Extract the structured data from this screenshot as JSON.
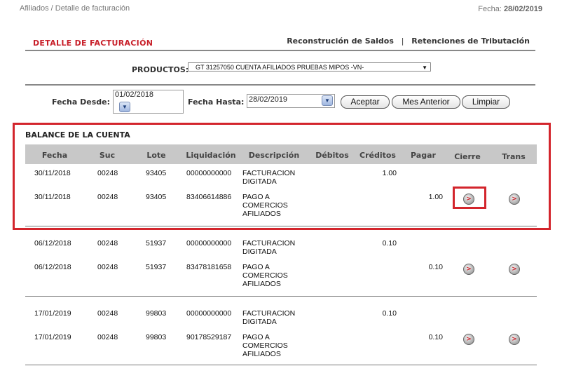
{
  "header": {
    "breadcrumb": "Afiliados / Detalle de facturación",
    "fecha_label": "Fecha:",
    "fecha_value": "28/02/2019"
  },
  "page_title": "DETALLE DE FACTURACIÓN",
  "links": {
    "reconstruccion": "Reconstrución de Saldos",
    "separator": "|",
    "retenciones": "Retenciones de Tributación"
  },
  "productos": {
    "label": "PRODUCTOS:",
    "selected": "GT 31257050 CUENTA AFILIADOS PRUEBAS MIPOS -VN-"
  },
  "filters": {
    "desde_label": "Fecha Desde:",
    "desde_value": "01/02/2018",
    "hasta_label": "Fecha Hasta:",
    "hasta_value": "28/02/2019",
    "aceptar": "Aceptar",
    "mes_anterior": "Mes Anterior",
    "limpiar": "Limpiar"
  },
  "balance": {
    "title": "BALANCE DE LA CUENTA",
    "columns": [
      "Fecha",
      "Suc",
      "Lote",
      "Liquidación",
      "Descripción",
      "Débitos",
      "Créditos",
      "Pagar",
      "Cierre",
      "Trans"
    ],
    "rows": [
      {
        "fecha": "30/11/2018",
        "suc": "00248",
        "lote": "93405",
        "liq": "00000000000",
        "desc": [
          "FACTURACION",
          "DIGITADA"
        ],
        "debitos": "",
        "creditos": "1.00",
        "pagar": "",
        "buttons": false
      },
      {
        "fecha": "30/11/2018",
        "suc": "00248",
        "lote": "93405",
        "liq": "83406614886",
        "desc": [
          "PAGO A",
          "COMERCIOS",
          "AFILIADOS"
        ],
        "debitos": "",
        "creditos": "",
        "pagar": "1.00",
        "buttons": true
      },
      {
        "fecha": "06/12/2018",
        "suc": "00248",
        "lote": "51937",
        "liq": "00000000000",
        "desc": [
          "FACTURACION",
          "DIGITADA"
        ],
        "debitos": "",
        "creditos": "0.10",
        "pagar": "",
        "buttons": false
      },
      {
        "fecha": "06/12/2018",
        "suc": "00248",
        "lote": "51937",
        "liq": "83478181658",
        "desc": [
          "PAGO A",
          "COMERCIOS",
          "AFILIADOS"
        ],
        "debitos": "",
        "creditos": "",
        "pagar": "0.10",
        "buttons": true
      },
      {
        "fecha": "17/01/2019",
        "suc": "00248",
        "lote": "99803",
        "liq": "00000000000",
        "desc": [
          "FACTURACION",
          "DIGITADA"
        ],
        "debitos": "",
        "creditos": "0.10",
        "pagar": "",
        "buttons": false
      },
      {
        "fecha": "17/01/2019",
        "suc": "00248",
        "lote": "99803",
        "liq": "90178529187",
        "desc": [
          "PAGO A",
          "COMERCIOS",
          "AFILIADOS"
        ],
        "debitos": "",
        "creditos": "",
        "pagar": "0.10",
        "buttons": true
      }
    ],
    "button_glyph": ">"
  },
  "colors": {
    "accent_red": "#d3252c",
    "header_gray": "#c8c8c8"
  },
  "icons": {
    "dropdown": "chevron-down-icon",
    "row_action": "arrow-right-circle-icon"
  }
}
